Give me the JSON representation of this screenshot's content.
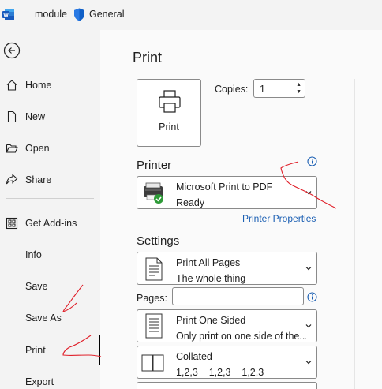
{
  "titlebar": {
    "doc_name": "module",
    "sensitivity_label": "General",
    "icons": [
      "word-logo-icon",
      "shield-icon"
    ]
  },
  "nav": {
    "items": [
      {
        "label": "Home",
        "icon": "home-icon"
      },
      {
        "label": "New",
        "icon": "new-document-icon"
      },
      {
        "label": "Open",
        "icon": "folder-open-icon"
      },
      {
        "label": "Share",
        "icon": "share-icon"
      },
      {
        "label": "Get Add-ins",
        "icon": "addins-grid-icon"
      },
      {
        "label": "Info"
      },
      {
        "label": "Save"
      },
      {
        "label": "Save As"
      },
      {
        "label": "Print",
        "selected": true
      },
      {
        "label": "Export"
      }
    ]
  },
  "main": {
    "title": "Print",
    "print_button_label": "Print",
    "copies_label": "Copies:",
    "copies_value": "1",
    "printer": {
      "heading": "Printer",
      "name": "Microsoft Print to PDF",
      "status": "Ready",
      "properties_link": "Printer Properties"
    },
    "settings": {
      "heading": "Settings",
      "pages_dropdown": {
        "line1": "Print All Pages",
        "line2": "The whole thing"
      },
      "pages_label": "Pages:",
      "pages_value": "",
      "sides_dropdown": {
        "line1": "Print One Sided",
        "line2": "Only print on one side of the..."
      },
      "collate_dropdown": {
        "line1": "Collated",
        "line2": "1,2,3    1,2,3    1,2,3"
      }
    }
  },
  "colors": {
    "accent": "#185abd",
    "nav_bg": "#f3f3f3",
    "main_bg": "#fafafa",
    "link": "#1b5fb3",
    "annotation": "#e0202a"
  }
}
